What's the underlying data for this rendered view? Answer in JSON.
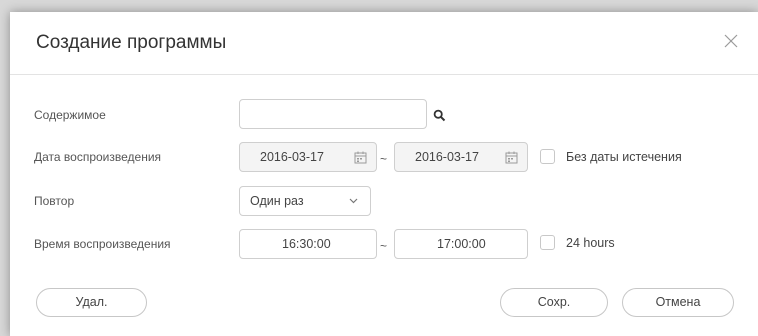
{
  "dialog": {
    "title": "Создание программы"
  },
  "form": {
    "content": {
      "label": "Содержимое",
      "value": "",
      "placeholder": ""
    },
    "playback_date": {
      "label": "Дата воспроизведения",
      "start": "2016-03-17",
      "end": "2016-03-17",
      "separator": "~",
      "no_expiry_label": "Без даты истечения",
      "no_expiry_checked": false
    },
    "repeat": {
      "label": "Повтор",
      "selected": "Один раз"
    },
    "playback_time": {
      "label": "Время воспроизведения",
      "start": "16:30:00",
      "end": "17:00:00",
      "separator": "~",
      "all_day_label": "24 hours",
      "all_day_checked": false
    }
  },
  "buttons": {
    "delete": "Удал.",
    "save": "Сохр.",
    "cancel": "Отмена"
  },
  "icons": {
    "close": "close-icon",
    "search": "search-icon",
    "calendar": "calendar-icon",
    "dropdown": "chevron-down-icon"
  },
  "colors": {
    "border": "#cfcfcf",
    "date_field_bg": "#f4f4f4",
    "text": "#444444",
    "overlay": "#d8d8d8"
  }
}
